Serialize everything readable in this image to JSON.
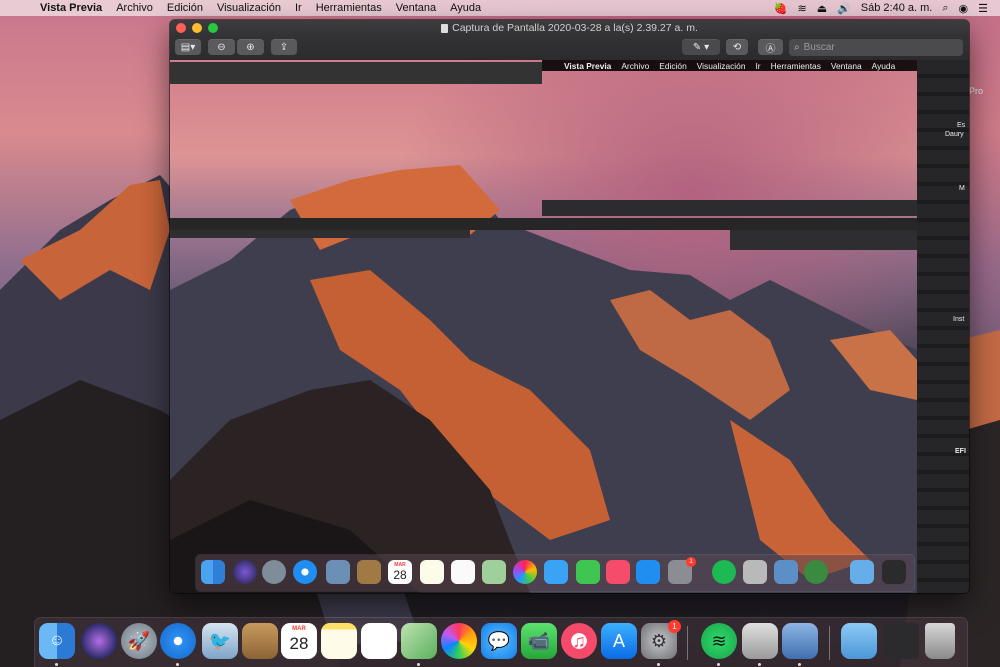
{
  "menubar": {
    "app_name": "Vista Previa",
    "items": [
      "Archivo",
      "Edición",
      "Visualización",
      "Ir",
      "Herramientas",
      "Ventana",
      "Ayuda"
    ],
    "clock": "Sáb 2:40 a. m."
  },
  "window": {
    "title": "Captura de Pantalla 2020-03-28 a la(s) 2.39.27 a. m.",
    "search_placeholder": "Buscar"
  },
  "inner_menubar": {
    "app_name": "Vista Previa",
    "items": [
      "Archivo",
      "Edición",
      "Visualización",
      "Ir",
      "Herramientas",
      "Ventana",
      "Ayuda"
    ]
  },
  "desktop_fragments": {
    "pro": "k Pro",
    "es": "Es",
    "daury": "Daury",
    "m": "M",
    "inst": "Inst",
    "efi": "EFI"
  },
  "dock": {
    "calendar_month": "MAR",
    "calendar_day": "28",
    "system_prefs_badge": "1"
  },
  "inner_dock": {
    "calendar_month": "MAR",
    "calendar_day": "28",
    "badge": "1"
  },
  "icons": {
    "apple": "apple-icon",
    "control_center": "control-strip-icon"
  }
}
